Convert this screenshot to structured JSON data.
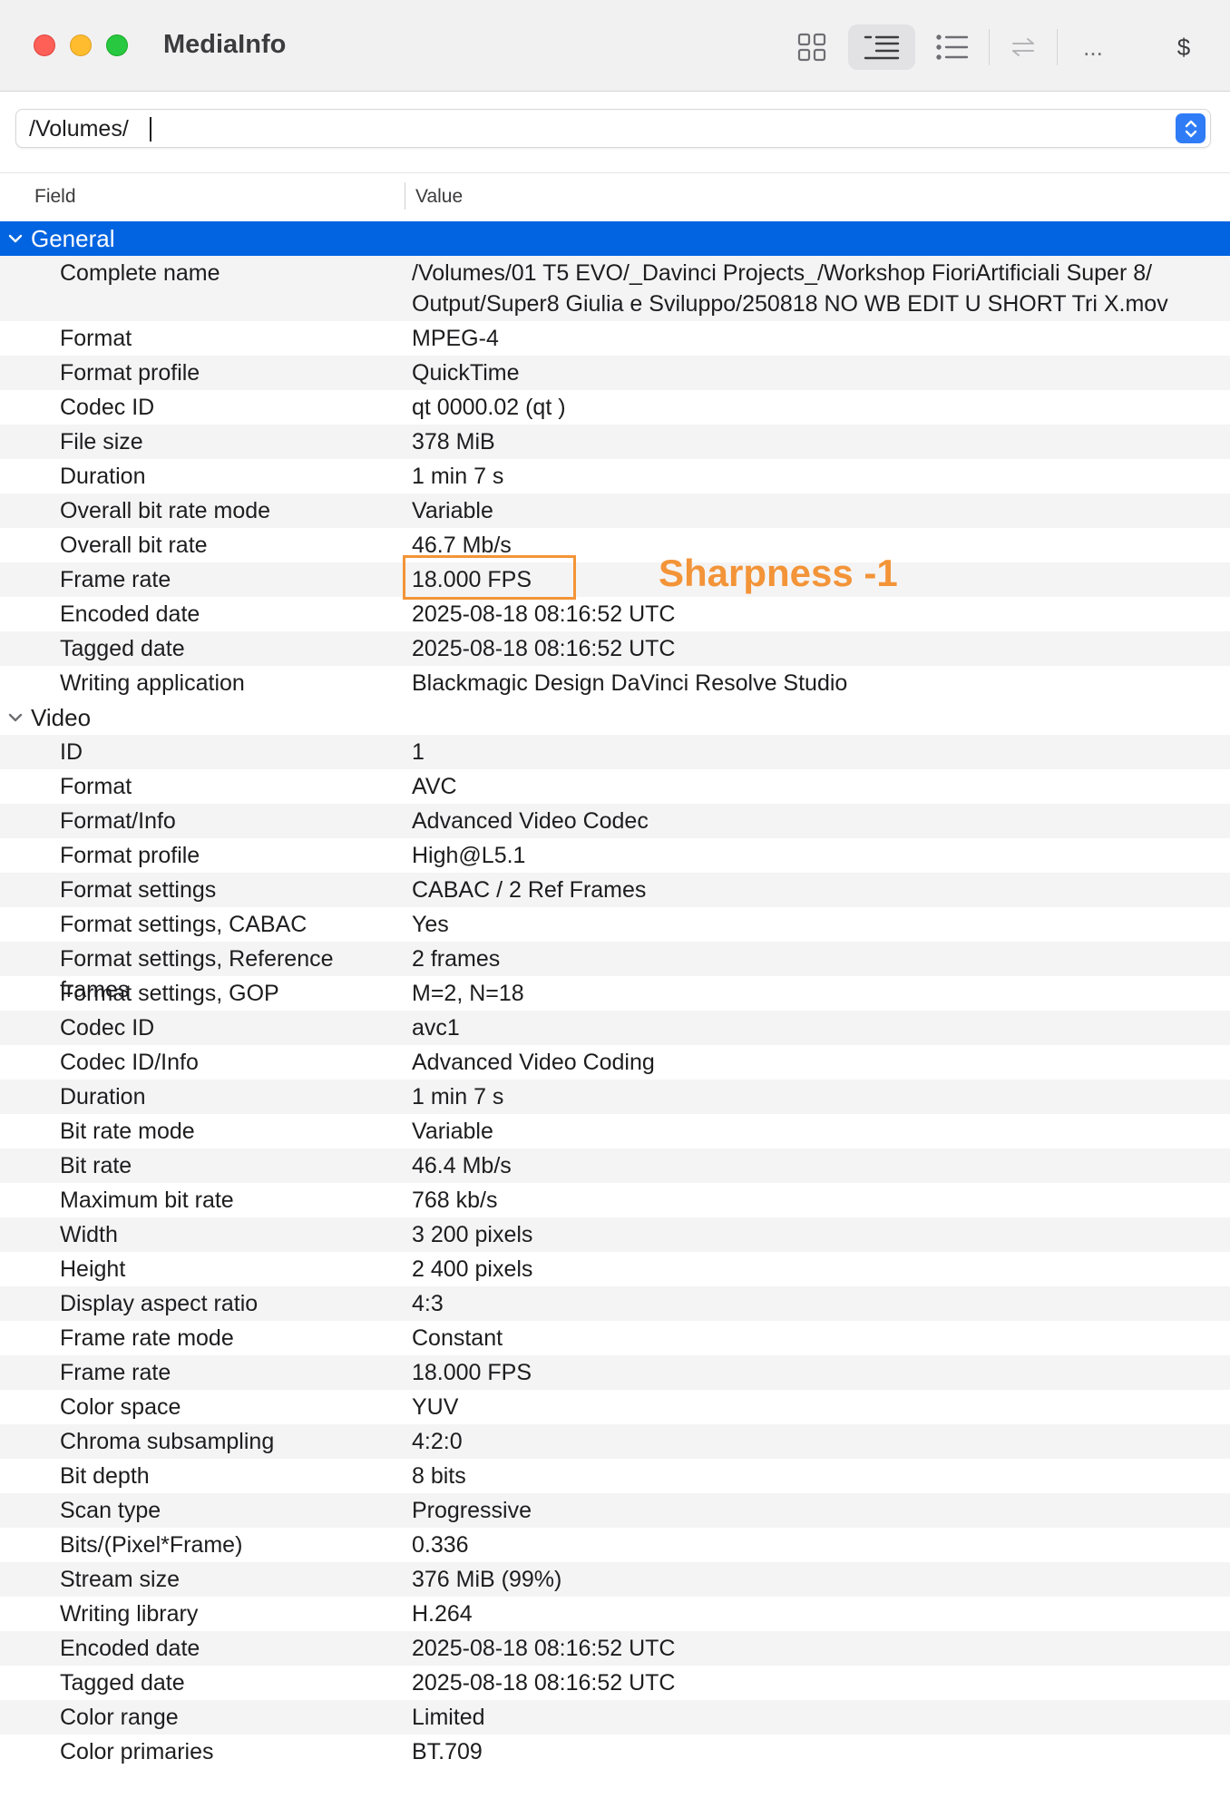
{
  "window": {
    "title": "MediaInfo"
  },
  "toolbar": {
    "more_label": "...",
    "dollar_label": "$"
  },
  "pathbar": {
    "value": "/Volumes/"
  },
  "columns": {
    "field": "Field",
    "value": "Value"
  },
  "sections": [
    {
      "name": "General",
      "rows": [
        {
          "field": "Complete name",
          "value": "/Volumes/01 T5 EVO/_Davinci Projects_/Workshop FioriArtificiali Super 8/ Output/Super8 Giulia e Sviluppo/250818 NO WB EDIT U SHORT Tri X.mov"
        },
        {
          "field": "Format",
          "value": "MPEG-4"
        },
        {
          "field": "Format profile",
          "value": "QuickTime"
        },
        {
          "field": "Codec ID",
          "value": "qt   0000.02 (qt  )"
        },
        {
          "field": "File size",
          "value": "378 MiB"
        },
        {
          "field": "Duration",
          "value": "1 min 7 s"
        },
        {
          "field": "Overall bit rate mode",
          "value": "Variable"
        },
        {
          "field": "Overall bit rate",
          "value": "46.7 Mb/s"
        },
        {
          "field": "Frame rate",
          "value": "18.000 FPS"
        },
        {
          "field": "Encoded date",
          "value": "2025-08-18 08:16:52 UTC"
        },
        {
          "field": "Tagged date",
          "value": "2025-08-18 08:16:52 UTC"
        },
        {
          "field": "Writing application",
          "value": "Blackmagic Design DaVinci Resolve Studio"
        }
      ]
    },
    {
      "name": "Video",
      "rows": [
        {
          "field": "ID",
          "value": "1"
        },
        {
          "field": "Format",
          "value": "AVC"
        },
        {
          "field": "Format/Info",
          "value": "Advanced Video Codec"
        },
        {
          "field": "Format profile",
          "value": "High@L5.1"
        },
        {
          "field": "Format settings",
          "value": "CABAC / 2 Ref Frames"
        },
        {
          "field": "Format settings, CABAC",
          "value": "Yes"
        },
        {
          "field": "Format settings, Reference frames",
          "value": "2 frames"
        },
        {
          "field": "Format settings, GOP",
          "value": "M=2, N=18"
        },
        {
          "field": "Codec ID",
          "value": "avc1"
        },
        {
          "field": "Codec ID/Info",
          "value": "Advanced Video Coding"
        },
        {
          "field": "Duration",
          "value": "1 min 7 s"
        },
        {
          "field": "Bit rate mode",
          "value": "Variable"
        },
        {
          "field": "Bit rate",
          "value": "46.4 Mb/s"
        },
        {
          "field": "Maximum bit rate",
          "value": "768 kb/s"
        },
        {
          "field": "Width",
          "value": "3 200 pixels"
        },
        {
          "field": "Height",
          "value": "2 400 pixels"
        },
        {
          "field": "Display aspect ratio",
          "value": "4:3"
        },
        {
          "field": "Frame rate mode",
          "value": "Constant"
        },
        {
          "field": "Frame rate",
          "value": "18.000 FPS"
        },
        {
          "field": "Color space",
          "value": "YUV"
        },
        {
          "field": "Chroma subsampling",
          "value": "4:2:0"
        },
        {
          "field": "Bit depth",
          "value": "8 bits"
        },
        {
          "field": "Scan type",
          "value": "Progressive"
        },
        {
          "field": "Bits/(Pixel*Frame)",
          "value": "0.336"
        },
        {
          "field": "Stream size",
          "value": "376 MiB (99%)"
        },
        {
          "field": "Writing library",
          "value": "H.264"
        },
        {
          "field": "Encoded date",
          "value": "2025-08-18 08:16:52 UTC"
        },
        {
          "field": "Tagged date",
          "value": "2025-08-18 08:16:52 UTC"
        },
        {
          "field": "Color range",
          "value": "Limited"
        },
        {
          "field": "Color primaries",
          "value": "BT.709"
        }
      ]
    }
  ],
  "annotation": {
    "text": "Sharpness -1",
    "color": "#f39438"
  },
  "colors": {
    "selection": "#0364e1",
    "stripe": "#f4f4f5",
    "accent": "#2f7cf6"
  }
}
